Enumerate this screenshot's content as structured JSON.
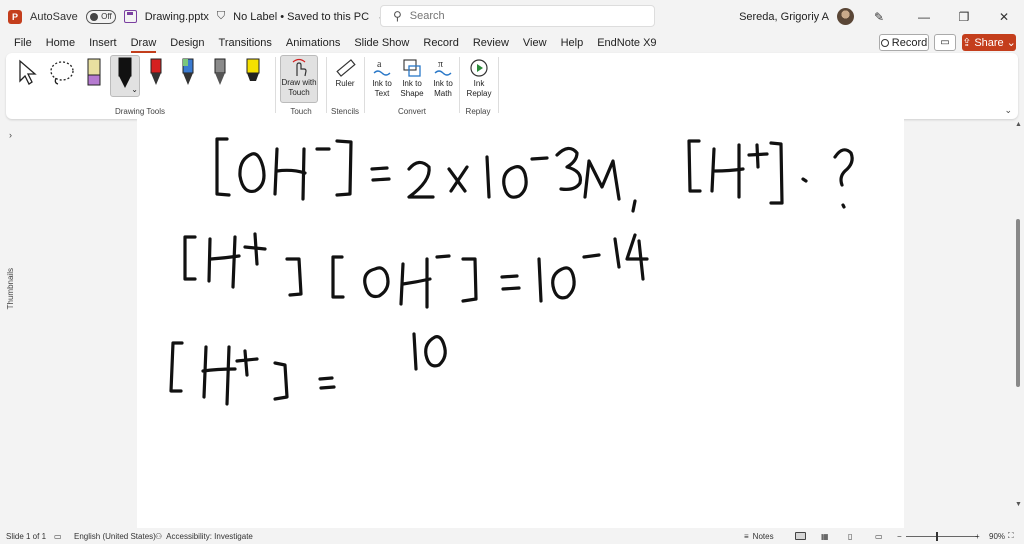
{
  "titlebar": {
    "autosave_label": "AutoSave",
    "autosave_state": "Off",
    "filename": "Drawing.pptx",
    "label_status": "No Label • Saved to this PC",
    "search_placeholder": "Search",
    "user_name": "Sereda, Grigoriy A"
  },
  "menu": {
    "tabs": [
      "File",
      "Home",
      "Insert",
      "Draw",
      "Design",
      "Transitions",
      "Animations",
      "Slide Show",
      "Record",
      "Review",
      "View",
      "Help",
      "EndNote X9"
    ],
    "active_tab": "Draw",
    "record_label": "Record",
    "share_label": "Share"
  },
  "ribbon": {
    "groups": {
      "drawing_tools": "Drawing Tools",
      "touch": "Touch",
      "stencils": "Stencils",
      "convert": "Convert",
      "replay": "Replay"
    },
    "buttons": {
      "draw_with_touch": "Draw with Touch",
      "ruler": "Ruler",
      "ink_to_text": "Ink to Text",
      "ink_to_shape": "Ink to Shape",
      "ink_to_math": "Ink to Math",
      "ink_replay": "Ink Replay"
    },
    "pen_colors": [
      "#e0e0a0",
      "#111111",
      "#d42020",
      "#3a7ad0",
      "#8a8a8a",
      "#f5e000"
    ]
  },
  "sidebar": {
    "thumbnails_label": "Thumbnails"
  },
  "statusbar": {
    "slide_info": "Slide 1 of 1",
    "language": "English (United States)",
    "accessibility": "Accessibility: Investigate",
    "notes_label": "Notes",
    "zoom_level": "90%"
  },
  "colors": {
    "accent": "#c43e1c",
    "ink": "#111111"
  }
}
